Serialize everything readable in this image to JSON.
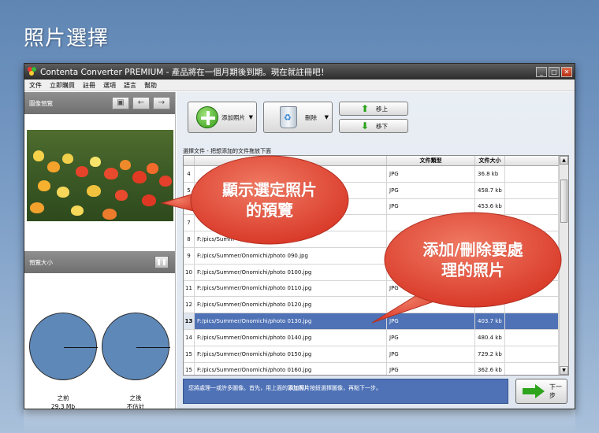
{
  "page": {
    "title": "照片選擇"
  },
  "window": {
    "title": "Contenta Converter PREMIUM - 產品將在一個月期後到期。現在就註冊吧！",
    "controls": [
      "_",
      "□",
      "✕"
    ]
  },
  "menu": [
    "文件",
    "立即購買",
    "註冊",
    "選項",
    "語言",
    "幫助"
  ],
  "left": {
    "preview_label": "圖像預覽",
    "size_label": "預覽大小",
    "before_label": "之前",
    "before_value": "29.3 Mb",
    "after_label": "之後",
    "after_value": "不估計"
  },
  "toolbar": {
    "add_label": "添加照片",
    "delete_label": "刪除",
    "up_label": "移上",
    "down_label": "移下"
  },
  "list": {
    "caption": "選擇文件 - 把想添加的文件拖放下面",
    "headers": [
      "",
      "",
      "文件類型",
      "文件大小",
      ""
    ],
    "rows": [
      {
        "n": "4",
        "path": "",
        "type": "JPG",
        "size": "36.8 kb"
      },
      {
        "n": "5",
        "path": "",
        "type": "JPG",
        "size": "458.7 kb"
      },
      {
        "n": "6",
        "path": "",
        "type": "JPG",
        "size": "453.6 kb"
      },
      {
        "n": "7",
        "path": "",
        "type": "",
        "size": ""
      },
      {
        "n": "8",
        "path": "F:/pics/Summ",
        "type": "",
        "size": ""
      },
      {
        "n": "9",
        "path": "F:/pics/Summer/Onomichi/photo 090.jpg",
        "type": "",
        "size": ""
      },
      {
        "n": "10",
        "path": "F:/pics/Summer/Onomichi/photo 0100.jpg",
        "type": "",
        "size": ""
      },
      {
        "n": "11",
        "path": "F:/pics/Summer/Onomichi/photo 0110.jpg",
        "type": "JPG",
        "size": ""
      },
      {
        "n": "12",
        "path": "F:/pics/Summer/Onomichi/photo 0120.jpg",
        "type": "",
        "size": "...7 kb"
      },
      {
        "n": "13",
        "path": "F:/pics/Summer/Onomichi/photo 0130.jpg",
        "type": "JPG",
        "size": "403.7 kb"
      },
      {
        "n": "14",
        "path": "F:/pics/Summer/Onomichi/photo 0140.jpg",
        "type": "JPG",
        "size": "480.4 kb"
      },
      {
        "n": "15",
        "path": "F:/pics/Summer/Onomichi/photo 0150.jpg",
        "type": "JPG",
        "size": "729.2 kb"
      },
      {
        "n": "15",
        "path": "F:/pics/Summer/Onomichi/photo 0160.jpg",
        "type": "JPG",
        "size": "362.6 kb"
      }
    ],
    "selected_index": 9
  },
  "hint": {
    "before": "您將處理一或許多圖像。首先，用上面的",
    "bold": "添加照片",
    "after": "按鈕選擇圖像，再點下一步。"
  },
  "next_label": "下一步",
  "callouts": {
    "preview_line1": "顯示選定照片",
    "preview_line2": "的預覽",
    "edit_line1": "添加/刪除要處",
    "edit_line2": "理的照片"
  },
  "colors": {
    "selection": "#4f72b6",
    "callout": "#e54a3a",
    "accent_green": "#2ea31c"
  }
}
